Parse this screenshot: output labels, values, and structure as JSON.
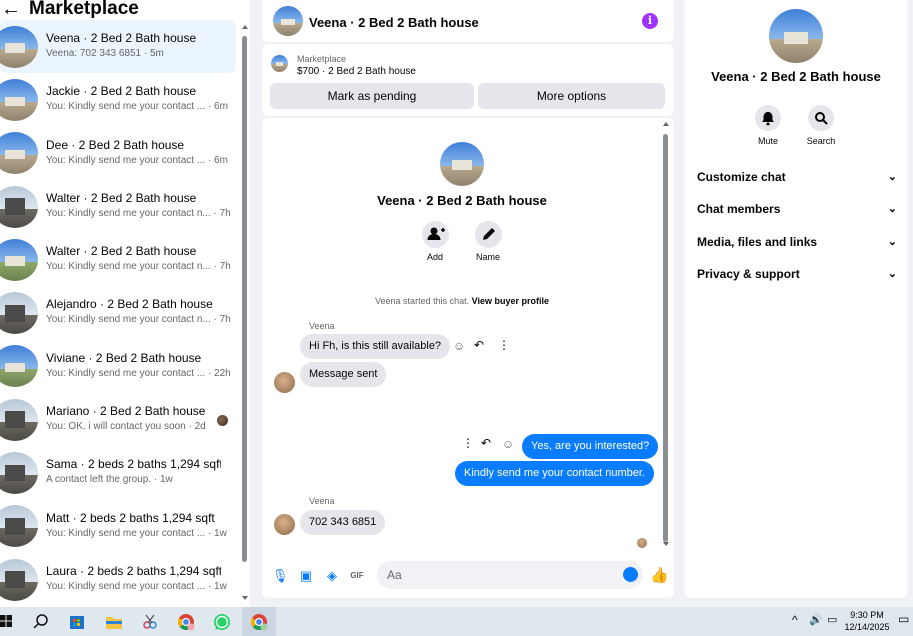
{
  "sidebar": {
    "title": "Marketplace",
    "conversations": [
      {
        "name": "Veena · 2 Bed 2 Bath house",
        "preview": "Veena: 702 343 6851 · 5m",
        "active": true
      },
      {
        "name": "Jackie · 2 Bed 2 Bath house",
        "preview": "You: Kindly send me your contact ... · 6m"
      },
      {
        "name": "Dee · 2 Bed 2 Bath house",
        "preview": "You: Kindly send me your contact ... · 6m"
      },
      {
        "name": "Walter · 2 Bed 2 Bath house",
        "preview": "You: Kindly send me your contact n... · 7h"
      },
      {
        "name": "Walter · 2 Bed 2 Bath house",
        "preview": "You: Kindly send me your contact n... · 7h"
      },
      {
        "name": "Alejandro · 2 Bed 2 Bath house",
        "preview": "You: Kindly send me your contact n... · 7h"
      },
      {
        "name": "Viviane · 2 Bed 2 Bath house",
        "preview": "You: Kindly send me your contact ... · 22h"
      },
      {
        "name": "Mariano · 2 Bed 2 Bath house",
        "preview": "You: OK. i will contact you soon · 2d"
      },
      {
        "name": "Sama · 2 beds 2 baths 1,294 sqft",
        "preview": "A contact left the group. · 1w"
      },
      {
        "name": "Matt · 2 beds 2 baths 1,294 sqft",
        "preview": "You: Kindly send me your contact ... · 1w"
      },
      {
        "name": "Laura · 2 beds 2 baths 1,294 sqft",
        "preview": "You: Kindly send me your contact ... · 1w"
      }
    ]
  },
  "chat_header": {
    "title": "Veena · 2 Bed 2 Bath house"
  },
  "listing": {
    "source": "Marketplace",
    "price_title": "$700 · 2 Bed 2 Bath house",
    "pending_label": "Mark as pending",
    "more_label": "More options"
  },
  "chat": {
    "title": "Veena · 2 Bed 2 Bath house",
    "add_label": "Add",
    "name_label": "Name",
    "system_note": "Veena started this chat.",
    "buyer_link": "View buyer profile",
    "sender_name": "Veena",
    "messages": {
      "m1": "Hi Fh, is this still available?",
      "m2": "Message sent",
      "m3": "Yes, are you interested?",
      "m4": "Kindly send me your contact number.",
      "m5": "702 343 6851"
    },
    "input_placeholder": "Aa",
    "gif_label": "GIF"
  },
  "details": {
    "title": "Veena · 2 Bed 2 Bath house",
    "mute_label": "Mute",
    "search_label": "Search",
    "sections": [
      "Customize chat",
      "Chat members",
      "Media, files and links",
      "Privacy & support"
    ]
  },
  "taskbar": {
    "time": "9:30 PM",
    "date": "12/14/2025"
  }
}
